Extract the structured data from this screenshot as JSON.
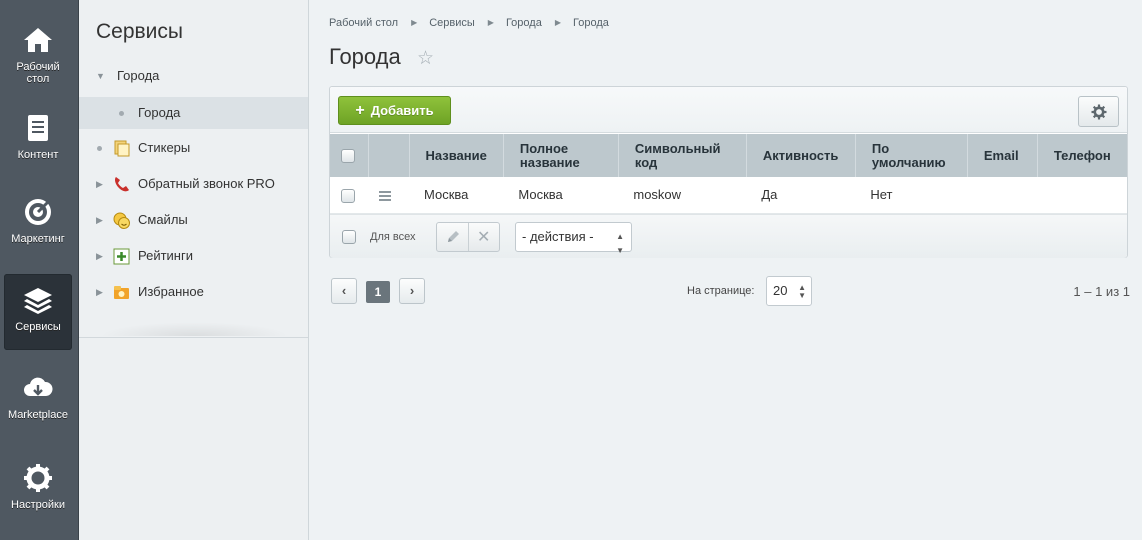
{
  "rail": {
    "items": [
      {
        "label": "Рабочий стол",
        "icon": "home-icon"
      },
      {
        "label": "Контент",
        "icon": "content-icon"
      },
      {
        "label": "Маркетинг",
        "icon": "target-icon"
      },
      {
        "label": "Сервисы",
        "icon": "layers-icon"
      },
      {
        "label": "Marketplace",
        "icon": "cloud-download-icon"
      },
      {
        "label": "Настройки",
        "icon": "gear-icon"
      }
    ]
  },
  "menu": {
    "title": "Сервисы",
    "items": [
      {
        "label": "Города"
      },
      {
        "label": "Города"
      },
      {
        "label": "Стикеры"
      },
      {
        "label": "Обратный звонок PRO"
      },
      {
        "label": "Смайлы"
      },
      {
        "label": "Рейтинги"
      },
      {
        "label": "Избранное"
      }
    ]
  },
  "breadcrumb": [
    "Рабочий стол",
    "Сервисы",
    "Города",
    "Города"
  ],
  "page": {
    "title": "Города"
  },
  "toolbar": {
    "add_label": "Добавить"
  },
  "table": {
    "columns": [
      "Название",
      "Полное название",
      "Символьный код",
      "Активность",
      "По умолчанию",
      "Email",
      "Телефон"
    ],
    "rows": [
      {
        "name": "Москва",
        "full_name": "Москва",
        "code": "moskow",
        "active": "Да",
        "default": "Нет",
        "email": "",
        "phone": ""
      }
    ]
  },
  "footer": {
    "for_all": "Для всех",
    "actions": "- действия -"
  },
  "pager": {
    "prev": "‹",
    "current": "1",
    "next": "›",
    "per_page_label": "На странице:",
    "per_page_value": "20",
    "count": "1 – 1 из 1"
  },
  "colors": {
    "accent": "#7cb32f",
    "rail_bg": "#4f5861",
    "header_bg": "#bdc8cd"
  }
}
